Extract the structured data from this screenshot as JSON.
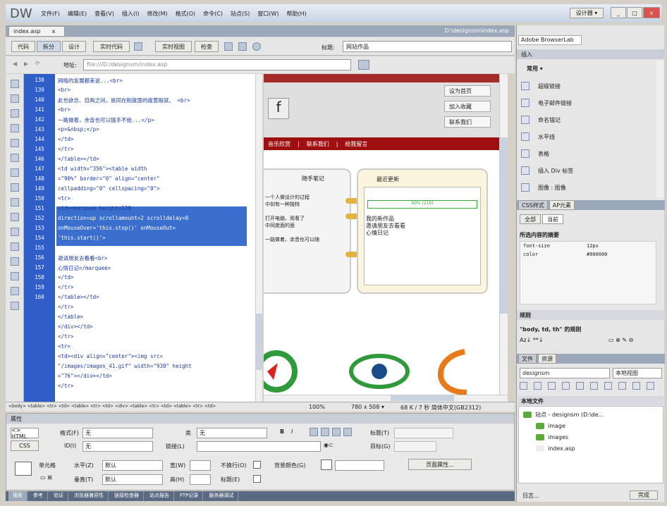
{
  "titlebar": {
    "logo": "DW",
    "menus": [
      "文件(F)",
      "编辑(E)",
      "查看(V)",
      "插入(I)",
      "修改(M)",
      "格式(O)",
      "命令(C)",
      "站点(S)",
      "窗口(W)",
      "帮助(H)"
    ],
    "workspace": "设计器 ▾",
    "win_buttons": [
      "_",
      "□",
      "x"
    ]
  },
  "doc": {
    "tab": "index.asp",
    "tab_close": "x",
    "path": "D:\\designsm\\index.asp",
    "view_buttons": [
      "代码",
      "拆分",
      "设计",
      "实时代码",
      "实时视图",
      "检查"
    ],
    "title_label": "标题:",
    "title_value": "网站作品",
    "addr_label": "地址:",
    "addr_value": "file:///D:/designsm/index.asp"
  },
  "code": {
    "line_numbers": [
      "138",
      "139",
      "140",
      "141",
      "142",
      "143",
      "144",
      "145",
      "146",
      "147",
      "148",
      "149",
      "150",
      "151",
      "152",
      "153",
      "154",
      "155",
      "156",
      "157",
      "158",
      "159",
      "160"
    ],
    "lines": [
      "网络的发展都来说...<br>",
      "<br>",
      "此也欲念、目两之间，是同在制度面的度意般就。 <br>",
      "<br>",
      "一路做着，余音也可以随手不绝...</p>",
      "<p>&nbsp;</p>",
      "</td>",
      "</tr>",
      "</table></td>",
      "<td width=\"356\"><table width",
      "=\"90%\" border=\"0\" align=\"center\"",
      "cellpadding=\"0\" cellspacing=\"0\">",
      "<tr>",
      "<td><marquee height=120",
      "direction=up scrollamount=2 scrolldelay=0",
      "onMouseOver='this.stop()' onMouseOut=",
      "'this.start()'>",
      "我的新作品<br>",
      "邀请朋友去看看<br>",
      "心情日记</marquee>",
      "</td>",
      "</tr>",
      "</table></td>",
      "</tr>",
      "</table>",
      "</div></td>",
      "</tr>",
      "<tr>",
      "<td><div align=\"center\"><img src=",
      "\"/images/images_41.gif\" width=\"930\" height",
      "=\"76\"></div></td>",
      "</tr>"
    ]
  },
  "design": {
    "buttons": [
      "设为首页",
      "加入收藏",
      "联系我们"
    ],
    "nav": [
      "音乐欣赏",
      "|",
      "联系我们",
      "|",
      "给我留言"
    ],
    "panel1_title": "随手笔记",
    "panel1_lines": [
      "一个人做设计的过程",
      "中刻有一种独特",
      "",
      "打开电脑，观看了",
      "中同度面的面",
      "",
      "一路做着，余音也可以随"
    ],
    "panel2_title": "最近更新",
    "panel2_bar": "60% (216)",
    "panel2_lines": [
      "我的新作品",
      "邀请朋友去看看",
      "心情日记"
    ]
  },
  "status": {
    "tags": "<body> <table> <tr> <td> <table> <tr> <td> <div> <table> <tr> <td> <table> <tr> <td>",
    "zoom": "100%",
    "size": "780 x 508 ▾",
    "info": "68 K / 7 秒  简体中文(GB2312)"
  },
  "props": {
    "title": "属性",
    "html_btn": "<> HTML",
    "css_btn": "CSS",
    "format_label": "格式(F)",
    "format_value": "无",
    "class_label": "类",
    "class_value": "无",
    "id_label": "ID(I)",
    "id_value": "无",
    "link_label": "链接(L)",
    "target_label": "目标(G)",
    "title_label": "标题(T)",
    "cell_label": "单元格",
    "horz_label": "水平(Z)",
    "horz_value": "默认",
    "vert_label": "垂直(T)",
    "vert_value": "默认",
    "w_label": "宽(W)",
    "h_label": "高(H)",
    "nowrap_label": "不换行(O)",
    "header_label": "标题(E)",
    "bg_label": "背景颜色(G)",
    "page_props": "页面属性..."
  },
  "results_tabs": [
    "搜索",
    "参考",
    "验证",
    "浏览器兼容性",
    "链接检查器",
    "站点报告",
    "FTP记录",
    "服务器调试"
  ],
  "right": {
    "adobe": "Adobe BrowserLab",
    "insert_title": "插入",
    "insert_category": "常用 ▾",
    "insert_items": [
      "超级链接",
      "电子邮件链接",
      "命名锚记",
      "水平线",
      "表格",
      "插入 Div 标签",
      "图像 : 图像"
    ],
    "css_tabs": [
      "CSS样式",
      "AP元素"
    ],
    "css_subtabs": [
      "全部",
      "当前"
    ],
    "css_summary": "所选内容的摘要",
    "css_props": [
      {
        "name": "font-size",
        "value": "12px"
      },
      {
        "name": "color",
        "value": "#000000"
      }
    ],
    "rules_title": "规则",
    "rules_text": "\"body, td, th\" 的规则",
    "rules_bottom": "Az↓ **↓",
    "files_tabs": [
      "文件",
      "资源"
    ],
    "site_select": "designsm",
    "view_select": "本地视图",
    "local_files": "本地文件",
    "tree": [
      {
        "label": "站点 - designsm (D:\\de..."
      },
      {
        "label": "image"
      },
      {
        "label": "images"
      },
      {
        "label": "index.asp"
      }
    ],
    "bottom_label": "日志...",
    "bottom_ok": "完成"
  }
}
